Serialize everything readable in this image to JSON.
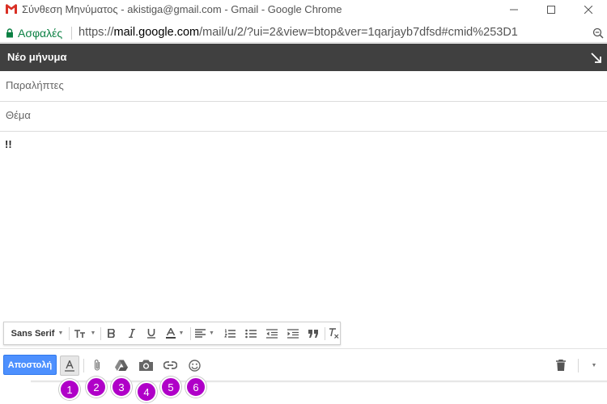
{
  "window": {
    "title": "Σύνθεση Μηνύματος - akistiga@gmail.com - Gmail - Google Chrome"
  },
  "addressbar": {
    "secure_label": "Ασφαλές",
    "url_scheme": "https://",
    "url_host": "mail.google.com",
    "url_path": "/mail/u/2/?ui=2&view=btop&ver=1qarjayb7dfsd#cmid%253D1"
  },
  "compose": {
    "title": "Νέο μήνυμα",
    "to_placeholder": "Παραλήπτες",
    "subject_placeholder": "Θέμα",
    "body_text": "!!"
  },
  "format_toolbar": {
    "font_label": "Sans Serif"
  },
  "bottom_toolbar": {
    "send_label": "Αποστολή"
  },
  "markers": [
    "1",
    "2",
    "3",
    "4",
    "5",
    "6"
  ],
  "colors": {
    "accent": "#4d90fe",
    "header": "#404040",
    "marker": "#b000c8",
    "secure": "#0b8043"
  }
}
